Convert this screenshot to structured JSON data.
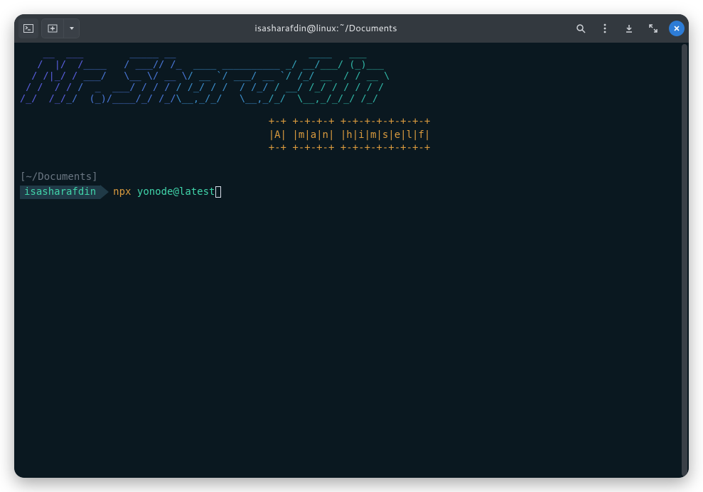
{
  "window": {
    "title": "isasharafdin@linux:~/Documents"
  },
  "banner": {
    "lines": [
      {
        "seg1": "    __  ___",
        "seg2": "        _____ __ ",
        "seg3": "                  ",
        "seg4": "    ____",
        "seg5": "   ___     ",
        "seg6": ""
      },
      {
        "seg1": "   /  |/  /",
        "seg2": "____   / ___// /_",
        "seg3": "  ____ __________",
        "seg4": " _/ __/",
        "seg5": "___/ (_)___ ",
        "seg6": ""
      },
      {
        "seg1": "  / /|_/ /",
        "seg2": " ___/   \\__ \\/ __ \\",
        "seg3": "/ __ `/ ___/ __ `",
        "seg4": "/ /_/ ",
        "seg5": "__  / / __ \\",
        "seg6": ""
      },
      {
        "seg1": " / /  / /",
        "seg2": " /  _  ___/ / / / ",
        "seg3": "/ /_/ / /  / /_/ ",
        "seg4": "/ __/ ",
        "seg5": "/_/ / / / / /",
        "seg6": ""
      },
      {
        "seg1": "/_/  /_/",
        "seg2": "_/  (_)/____/_/ /_/",
        "seg3": "\\__,_/_/   \\__,_",
        "seg4": "/_/  ",
        "seg5": "\\__,_/_/_/ /_/ ",
        "seg6": ""
      }
    ]
  },
  "subtitle": {
    "line1": "+-+ +-+-+-+ +-+-+-+-+-+-+-+",
    "line2": "|A| |m|a|n| |h|i|m|s|e|l|f|",
    "line3": "+-+ +-+-+-+ +-+-+-+-+-+-+-+"
  },
  "cwd": "[~/Documents]",
  "prompt": {
    "user": "isasharafdin",
    "bin": "npx",
    "arg": "yonode@latest"
  }
}
